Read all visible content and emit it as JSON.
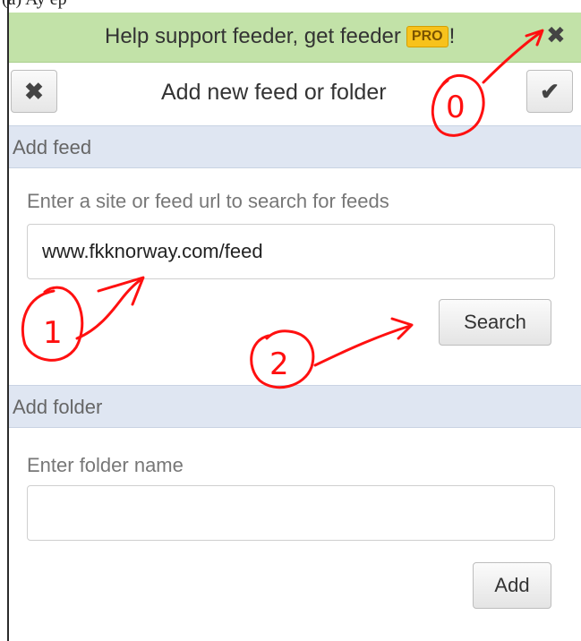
{
  "promo": {
    "text": "Help support feeder, get feeder",
    "badge": "PRO",
    "suffix": "!",
    "close_glyph": "✖"
  },
  "header": {
    "title": "Add new feed or folder",
    "cancel_glyph": "✖",
    "confirm_glyph": "✔"
  },
  "feed_section": {
    "heading": "Add feed",
    "label": "Enter a site or feed url to search for feeds",
    "value": "www.fkknorway.com/feed",
    "button": "Search"
  },
  "folder_section": {
    "heading": "Add folder",
    "label": "Enter folder name",
    "value": "",
    "button": "Add"
  },
  "annotations": {
    "marker_0": "0",
    "marker_1": "1",
    "marker_2": "2",
    "color": "#ff0000"
  }
}
